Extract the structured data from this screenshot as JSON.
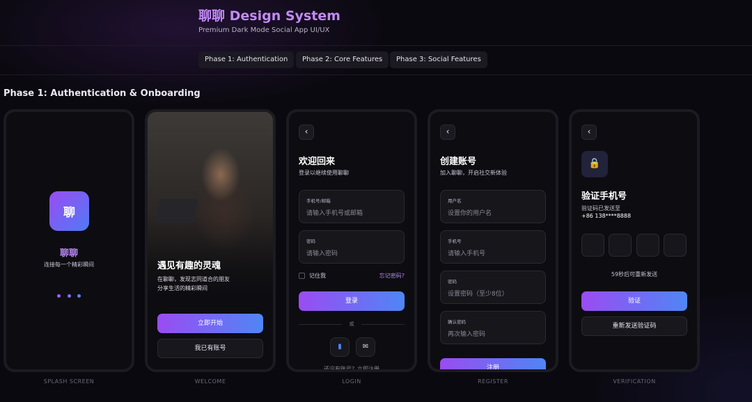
{
  "header": {
    "title": "聊聊 Design System",
    "subtitle": "Premium Dark Mode Social App UI/UX"
  },
  "nav": {
    "tabs": [
      {
        "label": "Phase 1: Authentication"
      },
      {
        "label": "Phase 2: Core Features"
      },
      {
        "label": "Phase 3: Social Features"
      }
    ]
  },
  "section_title": "Phase 1: Authentication & Onboarding",
  "colors": {
    "accent_purple": "#9a4cf2",
    "accent_blue": "#4f86f5",
    "background": "#0b0910",
    "link": "#b887f2"
  },
  "screens": {
    "splash": {
      "caption": "SPLASH SCREEN",
      "logo_char": "聊",
      "app_name": "聊聊",
      "tagline": "连接每一个精彩瞬间",
      "loading_dots": [
        "#a15cf0",
        "#7f6df3",
        "#5a82f5"
      ]
    },
    "welcome": {
      "caption": "WELCOME",
      "title": "遇见有趣的灵魂",
      "desc_line1": "在聊聊，发现志同道合的朋友",
      "desc_line2": "分享生活的精彩瞬间",
      "primary_button": "立即开始",
      "secondary_button": "我已有账号"
    },
    "login": {
      "caption": "LOGIN",
      "back_icon": "‹",
      "title": "欢迎回来",
      "subtitle": "登录以继续使用聊聊",
      "fields": [
        {
          "label": "手机号/邮箱",
          "placeholder": "请输入手机号或邮箱"
        },
        {
          "label": "密码",
          "placeholder": "请输入密码"
        }
      ],
      "remember_label": "记住我",
      "forgot_link": "忘记密码?",
      "submit_button": "登录",
      "divider_text": "或",
      "social_buttons": [
        {
          "icon": "phone-icon",
          "glyph": "▮"
        },
        {
          "icon": "mail-icon",
          "glyph": "✉"
        }
      ],
      "footer_text": "还没有账号？立即注册"
    },
    "register": {
      "caption": "REGISTER",
      "back_icon": "‹",
      "title": "创建账号",
      "subtitle": "加入聊聊，开启社交新体验",
      "fields": [
        {
          "label": "用户名",
          "placeholder": "设置你的用户名"
        },
        {
          "label": "手机号",
          "placeholder": "请输入手机号"
        },
        {
          "label": "密码",
          "placeholder": "设置密码（至少8位）"
        },
        {
          "label": "确认密码",
          "placeholder": "再次输入密码"
        }
      ],
      "submit_button": "注册"
    },
    "verification": {
      "caption": "VERIFICATION",
      "back_icon": "‹",
      "lock_icon": "🔒",
      "title": "验证手机号",
      "subtitle": "验证码已发送至",
      "phone": "+86 138****8888",
      "code_length": 4,
      "resend_timer": "59秒后可重新发送",
      "verify_button": "验证",
      "resend_button": "重新发送验证码"
    }
  }
}
